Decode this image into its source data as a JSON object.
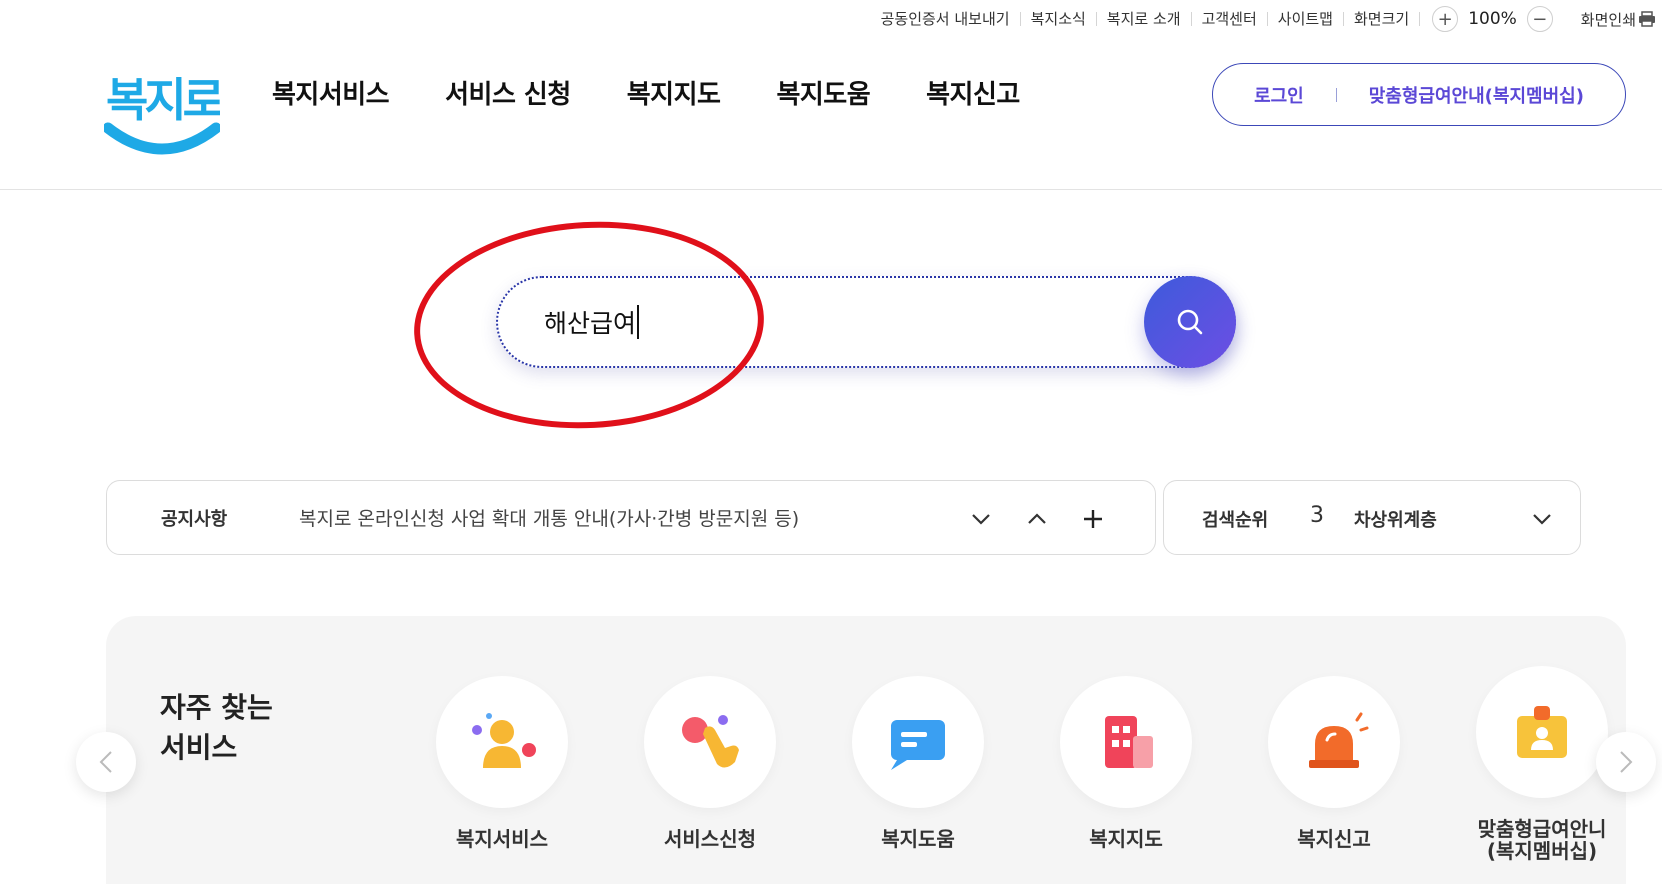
{
  "utility": {
    "links": [
      "공동인증서 내보내기",
      "복지소식",
      "복지로 소개",
      "고객센터",
      "사이트맵",
      "화면크기"
    ],
    "zoom_value": "100%",
    "print_label": "화면인쇄"
  },
  "logo": {
    "text": "복지로",
    "color": "#1ea9e6"
  },
  "gnb": [
    "복지서비스",
    "서비스 신청",
    "복지지도",
    "복지도움",
    "복지신고"
  ],
  "login": {
    "login_label": "로그인",
    "membership_label": "맞춤형급여안내(복지멤버십)"
  },
  "search": {
    "value": "해산급여"
  },
  "notice": {
    "label": "공지사항",
    "text": "복지로 온라인신청 사업 확대 개통 안내(가사·간병 방문지원 등)"
  },
  "rank": {
    "label": "검색순위",
    "number": "3",
    "term": "차상위계층"
  },
  "frequent": {
    "title": "자주 찾는\n서비스",
    "items": [
      {
        "name": "복지서비스",
        "icon": "people-icon"
      },
      {
        "name": "서비스신청",
        "icon": "hand-click-icon"
      },
      {
        "name": "복지도움",
        "icon": "message-card-icon"
      },
      {
        "name": "복지지도",
        "icon": "building-icon"
      },
      {
        "name": "복지신고",
        "icon": "siren-icon"
      },
      {
        "name": "맞춤형급여안니\n(복지멤버십)",
        "icon": "id-badge-icon"
      }
    ]
  },
  "colors": {
    "accent": "#3c48b8",
    "search_button": "#4a55de",
    "annotation_ring": "#e0101a"
  }
}
